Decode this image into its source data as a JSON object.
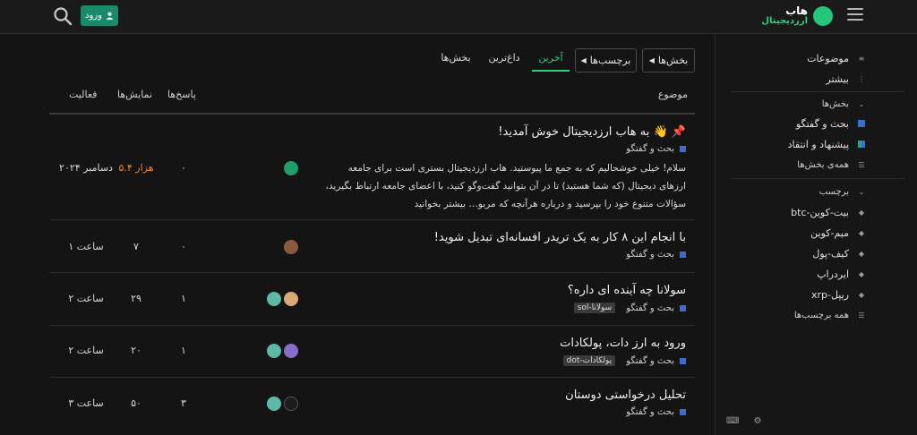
{
  "header": {
    "login_label": "ورود",
    "logo_line1": "هاب",
    "logo_line2": "ارزدیجیتال",
    "icons": [
      "search-icon",
      "user-icon",
      "hamburger-icon"
    ]
  },
  "sidebar": {
    "topics_label": "موضوعات",
    "more_label": "بیشتر",
    "categories_header": "بخش‌ها",
    "categories": [
      {
        "label": "بحث و گفتگو",
        "color": "#3a6bd6"
      },
      {
        "label": "پیشنهاد و انتقاد",
        "color": "#2f9e88"
      }
    ],
    "all_categories": "همه‌ی بخش‌ها",
    "tags_header": "برچسب",
    "tags": [
      "بیت-کوین-btc",
      "میم-کوین",
      "کیف-پول",
      "ایردراپ",
      "ریپل-xrp"
    ],
    "all_tags": "همه برچسب‌ها"
  },
  "nav": {
    "categories_btn": "بخش‌ها",
    "tags_btn": "برچسب‌ها",
    "tabs": [
      "آخرین",
      "داغ‌ترین",
      "بخش‌ها"
    ],
    "active_tab": "آخرین"
  },
  "table": {
    "columns": {
      "topic": "موضوع",
      "replies": "پاسخ‌ها",
      "views": "نمایش‌ها",
      "activity": "فعالیت"
    },
    "rows": [
      {
        "title": "به هاب ارزدیجیتال خوش آمدید!",
        "category": "بحث و گفتگو",
        "excerpt": "سلام! خیلی خوشحالیم که به جمع ما پیوستید. هاب ارزدیجیتال بستری است برای جامعه ارزهای دیجیتال (که شما هستید) تا در آن بتوانید گفت‌وگو کنید، با اعضای جامعه ارتباط بگیرید، سؤالات متنوع خود را بپرسید و درباره هرآنچه که مربو… بیشتر بخوانید",
        "replies": "۰",
        "views": "۵.۴ هزار",
        "activity": "دسامبر ۲۰۲۴"
      },
      {
        "title": "با انجام این ۸ کار به یک تریدر افسانه‌ای تبدیل شوید!",
        "category": "بحث و گفتگو",
        "replies": "۰",
        "views": "۷",
        "activity": "۱ ساعت"
      },
      {
        "title": "سولانا چه آینده ای داره؟",
        "category": "بحث و گفتگو",
        "tag": "سولانا-sol",
        "replies": "۱",
        "views": "۲۹",
        "activity": "۲ ساعت"
      },
      {
        "title": "ورود به ارز دات، پولکادات",
        "category": "بحث و گفتگو",
        "tag": "پولکادات-dot",
        "replies": "۱",
        "views": "۲۰",
        "activity": "۲ ساعت"
      },
      {
        "title": "تحلیل درخواستی دوستان",
        "category": "بحث و گفتگو",
        "replies": "۳",
        "views": "۵۰",
        "activity": "۳ ساعت"
      }
    ]
  }
}
